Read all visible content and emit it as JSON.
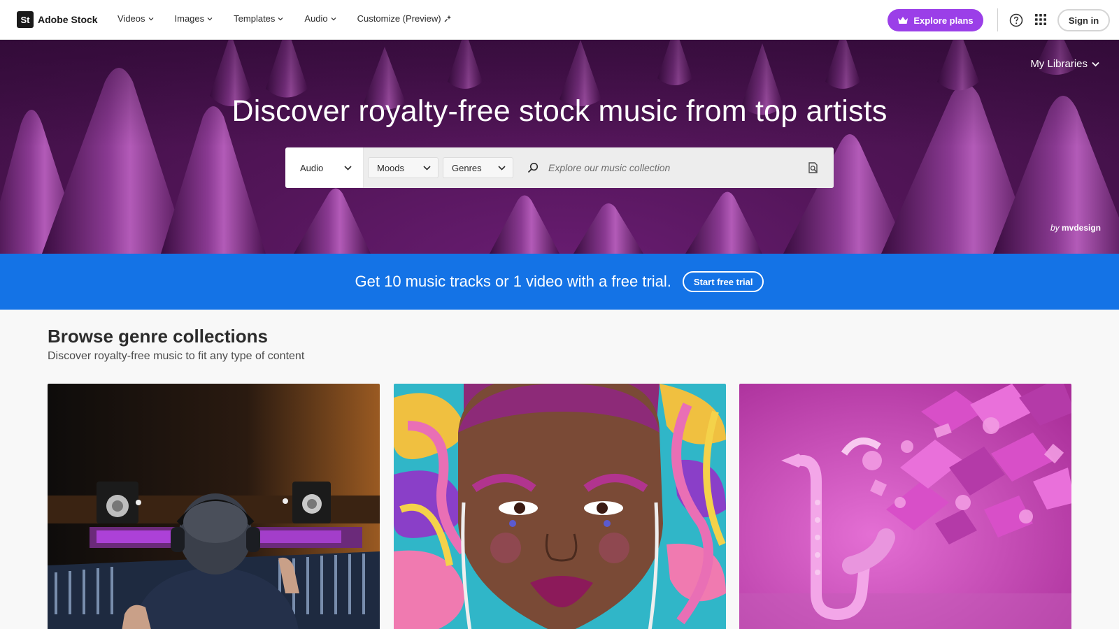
{
  "header": {
    "logo_mark": "St",
    "logo_text": "Adobe Stock",
    "nav": [
      {
        "label": "Videos"
      },
      {
        "label": "Images"
      },
      {
        "label": "Templates"
      },
      {
        "label": "Audio"
      },
      {
        "label": "Customize (Preview)"
      }
    ],
    "explore_label": "Explore plans",
    "signin_label": "Sign in"
  },
  "hero": {
    "my_libraries": "My Libraries",
    "title": "Discover royalty-free stock music from top artists",
    "search": {
      "type_value": "Audio",
      "moods_label": "Moods",
      "genres_label": "Genres",
      "placeholder": "Explore our music collection"
    },
    "credit_by": "by",
    "credit_artist": "mvdesign"
  },
  "trial": {
    "text": "Get 10 music tracks or 1 video with a free trial.",
    "button_label": "Start free trial"
  },
  "browse": {
    "title": "Browse genre collections",
    "subtitle": "Discover royalty-free music to fit any type of content"
  },
  "colors": {
    "brand_purple": "#9b3fe8",
    "trial_blue": "#1473e6",
    "hero_purple": "#521558"
  }
}
